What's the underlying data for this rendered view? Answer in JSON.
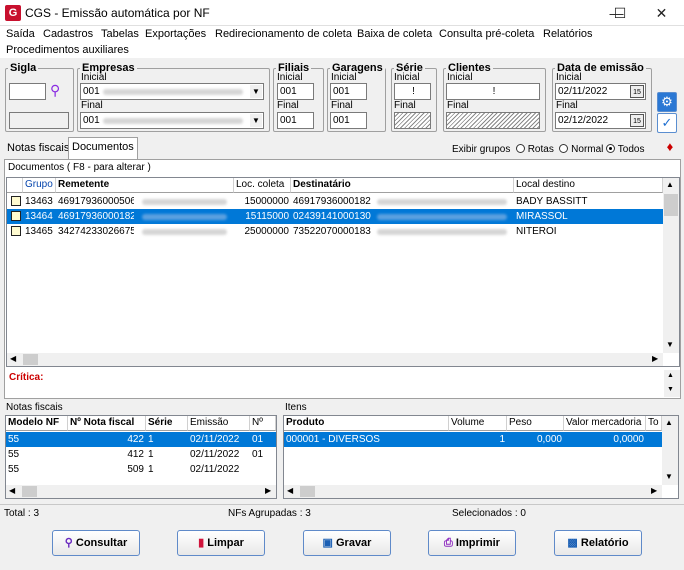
{
  "window": {
    "title": "CGS - Emissão automática por NF",
    "icon_letter": "G"
  },
  "menu": [
    "Saída",
    "Cadastros",
    "Tabelas",
    "Exportações",
    "Redirecionamento de coleta",
    "Baixa de coleta",
    "Consulta pré-coleta",
    "Relatórios",
    "Procedimentos auxiliares"
  ],
  "filters": {
    "sigla": {
      "legend": "Sigla"
    },
    "empresas": {
      "legend": "Empresas",
      "inicial_label": "Inicial",
      "final_label": "Final",
      "inicial_value": "001",
      "final_value": "001"
    },
    "filiais": {
      "legend": "Filiais",
      "inicial_label": "Inicial",
      "final_label": "Final",
      "inicial_value": "001",
      "final_value": "001"
    },
    "garagens": {
      "legend": "Garagens",
      "inicial_label": "Inicial",
      "final_label": "Final",
      "inicial_value": "001",
      "final_value": "001"
    },
    "serie": {
      "legend": "Série",
      "inicial_label": "Inicial",
      "final_label": "Final",
      "inicial_value": "!"
    },
    "clientes": {
      "legend": "Clientes",
      "inicial_label": "Inicial",
      "final_label": "Final",
      "inicial_value": "!"
    },
    "data_emissao": {
      "legend": "Data de emissão",
      "inicial_label": "Inicial",
      "final_label": "Final",
      "inicial_value": "02/11/2022",
      "final_value": "02/12/2022",
      "cal_label": "15"
    }
  },
  "tabs": {
    "notas": "Notas fiscais",
    "documentos": "Documentos"
  },
  "exibir": {
    "label": "Exibir grupos",
    "opts": [
      "Rotas",
      "Normal",
      "Todos"
    ],
    "selected": "Todos"
  },
  "documentos": {
    "title": "Documentos ( F8 - para alterar )",
    "headers": [
      "Grupo",
      "Remetente",
      "Loc. coleta",
      "Destinatário",
      "Local destino"
    ],
    "rows": [
      {
        "grupo": "13463",
        "remetente": "46917936000506",
        "loc": "15000000",
        "dest": "46917936000182",
        "local": "BADY BASSITT"
      },
      {
        "grupo": "13464",
        "remetente": "46917936000182",
        "loc": "15115000",
        "dest": "02439141000130",
        "local": "MIRASSOL"
      },
      {
        "grupo": "13465",
        "remetente": "34274233026675",
        "loc": "25000000",
        "dest": "73522070000183",
        "local": "NITEROI"
      }
    ]
  },
  "critica": {
    "label": "Crítica:"
  },
  "notas": {
    "title": "Notas fiscais",
    "headers": [
      "Modelo NF",
      "Nº Nota fiscal",
      "Série",
      "Emissão",
      "Nº"
    ],
    "rows": [
      {
        "modelo": "55",
        "num": "422",
        "serie": "1",
        "emissao": "02/11/2022",
        "n": "01"
      },
      {
        "modelo": "55",
        "num": "412",
        "serie": "1",
        "emissao": "02/11/2022",
        "n": "01"
      },
      {
        "modelo": "55",
        "num": "509",
        "serie": "1",
        "emissao": "02/11/2022",
        "n": ""
      }
    ]
  },
  "itens": {
    "title": "Itens",
    "headers": [
      "Produto",
      "Volume",
      "Peso",
      "Valor mercadoria",
      "To"
    ],
    "rows": [
      {
        "produto": "000001 - DIVERSOS",
        "volume": "1",
        "peso": "0,000",
        "valor": "0,0000"
      }
    ]
  },
  "status": {
    "total": "Total : 3",
    "agrupadas": "NFs Agrupadas : 3",
    "selecionados": "Selecionados : 0"
  },
  "buttons": {
    "consultar": "Consultar",
    "limpar": "Limpar",
    "gravar": "Gravar",
    "imprimir": "Imprimir",
    "relatorio": "Relatório"
  },
  "colors": {
    "selection": "#0078d7",
    "header_link": "#0645ad",
    "critica": "#cc0000"
  }
}
